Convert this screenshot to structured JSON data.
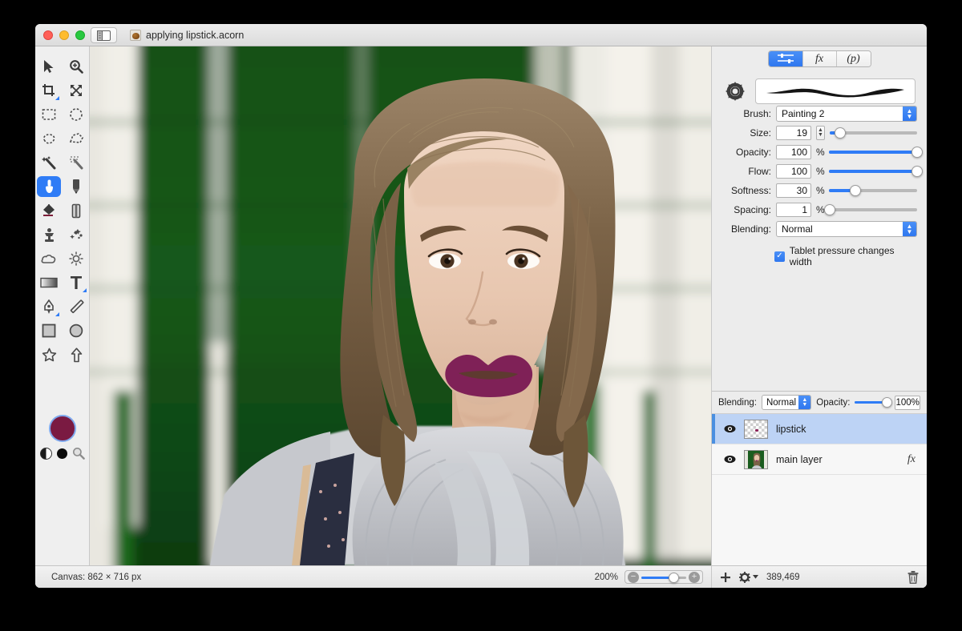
{
  "window": {
    "title": "applying lipstick.acorn",
    "traffic_lights": [
      "close",
      "minimize",
      "maximize"
    ],
    "sidebar_toggle": "sidebar-toggle"
  },
  "tools": [
    {
      "name": "move-tool",
      "icon": "arrow-cursor",
      "selected": false
    },
    {
      "name": "zoom-tool",
      "icon": "magnifier-plus",
      "selected": false
    },
    {
      "name": "crop-tool",
      "icon": "crop",
      "selected": false,
      "submenu": true
    },
    {
      "name": "transform-tool",
      "icon": "four-arrows",
      "selected": false
    },
    {
      "name": "rect-select-tool",
      "icon": "dashed-rectangle",
      "selected": false
    },
    {
      "name": "ellipse-select-tool",
      "icon": "dashed-ellipse",
      "selected": false
    },
    {
      "name": "lasso-tool",
      "icon": "lasso",
      "selected": false
    },
    {
      "name": "polygon-lasso-tool",
      "icon": "polygon-lasso",
      "selected": false
    },
    {
      "name": "magic-wand-tool",
      "icon": "magic-wand",
      "selected": false
    },
    {
      "name": "instant-alpha-tool",
      "icon": "sparkle-wand",
      "selected": false
    },
    {
      "name": "brush-tool",
      "icon": "paint-brush",
      "selected": true
    },
    {
      "name": "pencil-tool",
      "icon": "pencil",
      "selected": false
    },
    {
      "name": "bucket-fill-tool",
      "icon": "paint-bucket",
      "selected": false
    },
    {
      "name": "eraser-tool",
      "icon": "eraser",
      "selected": false
    },
    {
      "name": "clone-stamp-tool",
      "icon": "clone-stamp",
      "selected": false
    },
    {
      "name": "smudge-tool",
      "icon": "smudge",
      "selected": false
    },
    {
      "name": "blur-tool",
      "icon": "cloud-blur",
      "selected": false
    },
    {
      "name": "dodge-burn-tool",
      "icon": "sun-dodge",
      "selected": false
    },
    {
      "name": "gradient-tool",
      "icon": "gradient",
      "selected": false
    },
    {
      "name": "text-tool",
      "icon": "text-t",
      "selected": false,
      "submenu": true
    },
    {
      "name": "bezier-pen-tool",
      "icon": "pen-nib",
      "selected": false,
      "submenu": true
    },
    {
      "name": "line-tool",
      "icon": "line",
      "selected": false
    },
    {
      "name": "rectangle-shape-tool",
      "icon": "rectangle",
      "selected": false
    },
    {
      "name": "ellipse-shape-tool",
      "icon": "ellipse",
      "selected": false
    },
    {
      "name": "star-shape-tool",
      "icon": "star",
      "selected": false
    },
    {
      "name": "arrow-shape-tool",
      "icon": "arrow-up",
      "selected": false
    }
  ],
  "colors": {
    "foreground": "#7a1a42",
    "accent_blue": "#2f7cf6",
    "selection_blue": "#bdd3f5",
    "lipstick": "#7f2157"
  },
  "inspector": {
    "segments": [
      {
        "name": "tool-options-tab",
        "label": "",
        "icon": "tool-options-icon",
        "active": true
      },
      {
        "name": "filters-tab",
        "label": "fx",
        "active": false
      },
      {
        "name": "presets-tab",
        "label": "(p)",
        "active": false
      }
    ],
    "gear_icon": "gear-icon",
    "brush_preview": "brush-stroke-preview",
    "brush": {
      "label": "Brush:",
      "value": "Painting 2"
    },
    "size": {
      "label": "Size:",
      "value": "19",
      "slider_pct": 12
    },
    "opacity": {
      "label": "Opacity:",
      "value": "100",
      "unit": "%",
      "slider_pct": 100
    },
    "flow": {
      "label": "Flow:",
      "value": "100",
      "unit": "%",
      "slider_pct": 100
    },
    "softness": {
      "label": "Softness:",
      "value": "30",
      "unit": "%",
      "slider_pct": 30
    },
    "spacing": {
      "label": "Spacing:",
      "value": "1",
      "unit": "%",
      "slider_pct": 1
    },
    "blending": {
      "label": "Blending:",
      "value": "Normal"
    },
    "tablet_pressure": {
      "label": "Tablet pressure changes width",
      "checked": true
    }
  },
  "layers_panel": {
    "blending_label": "Blending:",
    "blending_value": "Normal",
    "opacity_label": "Opacity:",
    "opacity_value": "100%",
    "rows": [
      {
        "name": "lipstick",
        "visible": true,
        "selected": true,
        "thumb": "transparent-checker",
        "fx": ""
      },
      {
        "name": "main layer",
        "visible": true,
        "selected": false,
        "thumb": "photo",
        "fx": "fx"
      }
    ],
    "add_layer_icon": "plus-icon",
    "layer_actions_icon": "gear-icon",
    "memory": "389,469",
    "delete_icon": "trash-icon"
  },
  "statusbar": {
    "canvas_size": "Canvas: 862 × 716 px",
    "zoom": "200%",
    "zoom_out_icon": "zoom-out-icon",
    "zoom_in_icon": "zoom-in-icon",
    "zoom_slider_pct": 44
  }
}
